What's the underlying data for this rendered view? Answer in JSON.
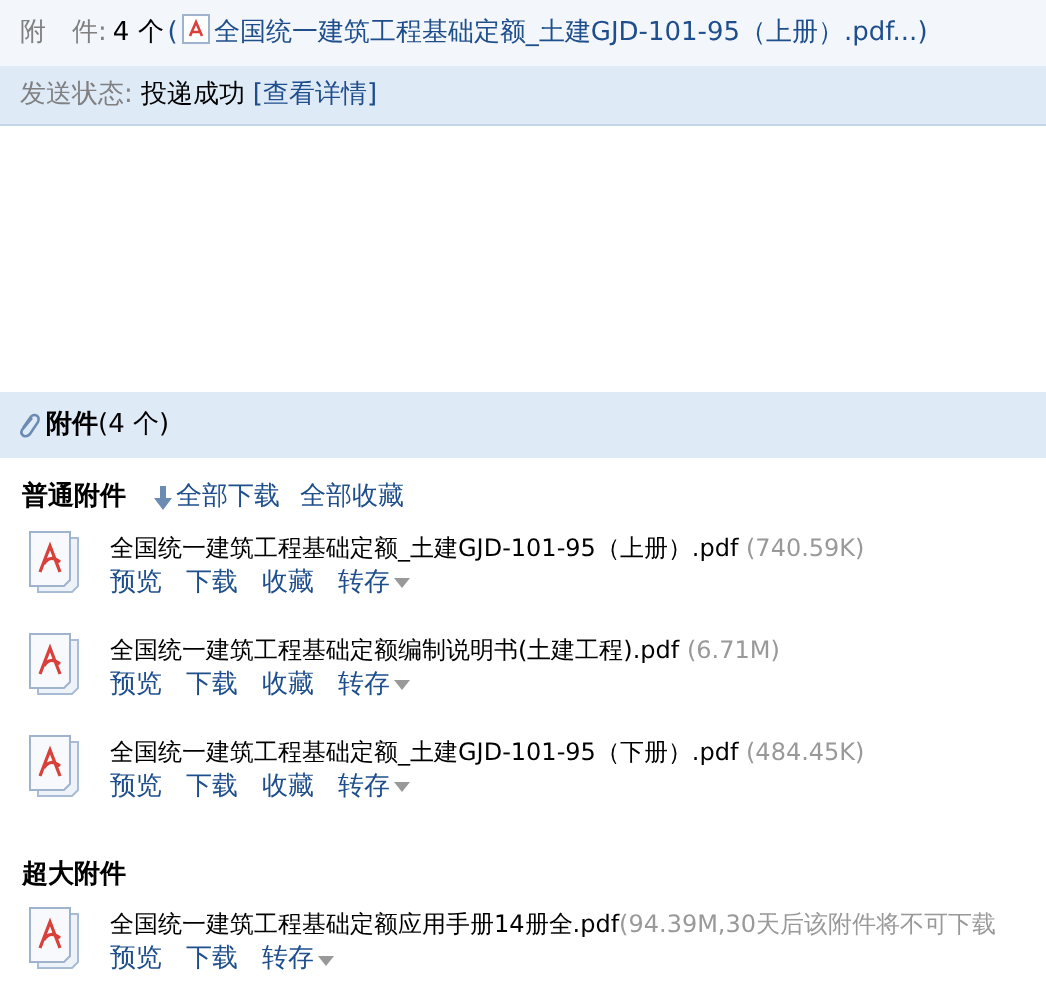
{
  "header": {
    "attachments_label": "附　件:",
    "attachments_count": "4 个",
    "attachments_open": "(",
    "attachments_first": "全国统一建筑工程基础定额_土建GJD-101-95（上册）.pdf...",
    "attachments_close": ")",
    "status_label": "发送状态:",
    "status_value": "投递成功",
    "status_link": "[查看详情]"
  },
  "attachments": {
    "title": "附件",
    "count": "(4 个)",
    "sections": [
      {
        "title": "普通附件",
        "actions": [
          {
            "label": "全部下载",
            "kind": "download"
          },
          {
            "label": "全部收藏",
            "kind": "plain"
          }
        ],
        "files": [
          {
            "name": "全国统一建筑工程基础定额_土建GJD-101-95（上册）.pdf",
            "size": " (740.59K)",
            "actions": [
              {
                "label": "预览",
                "menu": false
              },
              {
                "label": "下载",
                "menu": false
              },
              {
                "label": "收藏",
                "menu": false
              },
              {
                "label": "转存",
                "menu": true
              }
            ]
          },
          {
            "name": "全国统一建筑工程基础定额编制说明书(土建工程).pdf",
            "size": " (6.71M)",
            "actions": [
              {
                "label": "预览",
                "menu": false
              },
              {
                "label": "下载",
                "menu": false
              },
              {
                "label": "收藏",
                "menu": false
              },
              {
                "label": "转存",
                "menu": true
              }
            ]
          },
          {
            "name": "全国统一建筑工程基础定额_土建GJD-101-95（下册）.pdf",
            "size": " (484.45K)",
            "actions": [
              {
                "label": "预览",
                "menu": false
              },
              {
                "label": "下载",
                "menu": false
              },
              {
                "label": "收藏",
                "menu": false
              },
              {
                "label": "转存",
                "menu": true
              }
            ]
          }
        ]
      },
      {
        "title": "超大附件",
        "files": [
          {
            "name": "全国统一建筑工程基础定额应用手册14册全.pdf",
            "size": "(94.39M,30天后该附件将不可下载",
            "actions": [
              {
                "label": "预览",
                "menu": false
              },
              {
                "label": "下载",
                "menu": false
              },
              {
                "label": "转存",
                "menu": true
              }
            ]
          }
        ]
      }
    ]
  }
}
